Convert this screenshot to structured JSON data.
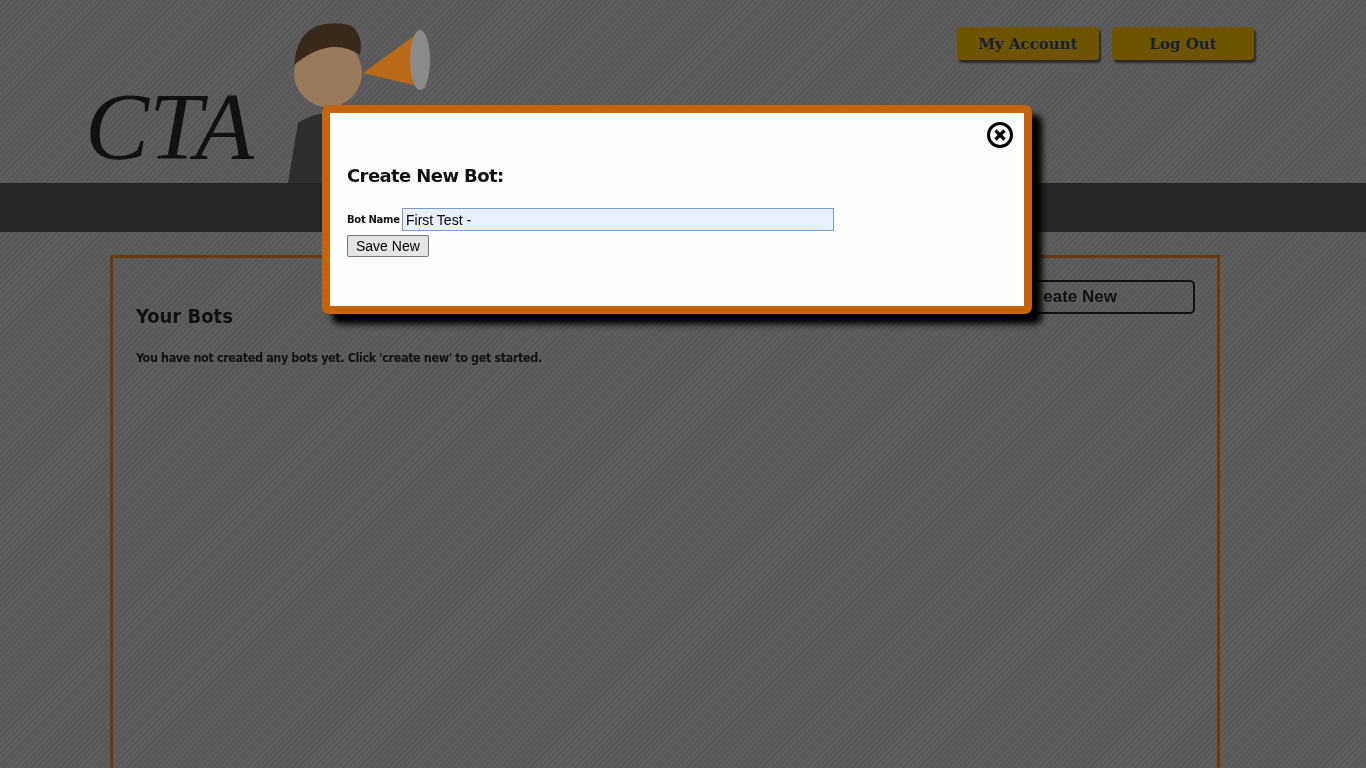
{
  "header": {
    "logo_text": "CTA",
    "nav_buttons": [
      "My Account",
      "Log Out"
    ]
  },
  "content": {
    "title": "Your Bots",
    "message": "You have not created any bots yet. Click 'create new' to get started.",
    "create_button": "eate New"
  },
  "modal": {
    "title": "Create New Bot:",
    "field_label": "Bot Name",
    "field_value": "First Test -",
    "save_button": "Save New"
  }
}
